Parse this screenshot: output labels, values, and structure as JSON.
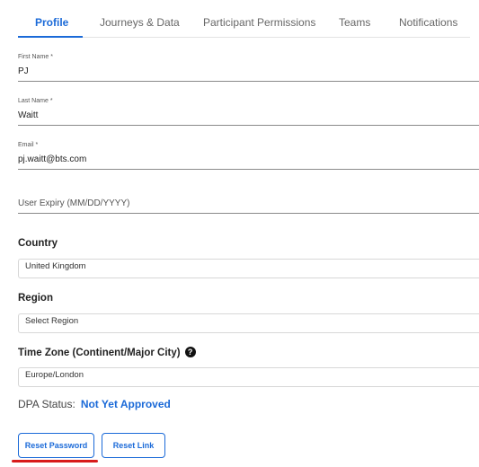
{
  "tabs": [
    {
      "label": "Profile",
      "active": true
    },
    {
      "label": "Journeys & Data",
      "active": false
    },
    {
      "label": "Participant Permissions",
      "active": false
    },
    {
      "label": "Teams",
      "active": false
    },
    {
      "label": "Notifications",
      "active": false
    }
  ],
  "form": {
    "first_name": {
      "label": "First Name",
      "required_mark": "*",
      "value": "PJ"
    },
    "last_name": {
      "label": "Last Name",
      "required_mark": "*",
      "value": "Waitt"
    },
    "email": {
      "label": "Email",
      "required_mark": "*",
      "value": "pj.waitt@bts.com"
    },
    "user_expiry": {
      "placeholder": "User Expiry (MM/DD/YYYY)",
      "value": ""
    }
  },
  "country": {
    "title": "Country",
    "selected": "United Kingdom"
  },
  "region": {
    "title": "Region",
    "selected": "Select Region"
  },
  "timezone": {
    "title": "Time Zone (Continent/Major City)",
    "help_glyph": "?",
    "selected": "Europe/London"
  },
  "dpa": {
    "label": "DPA Status:",
    "value": "Not Yet Approved"
  },
  "buttons": {
    "reset_password": "Reset Password",
    "reset_link": "Reset Link"
  },
  "colors": {
    "accent": "#1b6ad8",
    "annotation": "#d81b1b"
  },
  "icons": {
    "help": "question-circle-icon"
  }
}
